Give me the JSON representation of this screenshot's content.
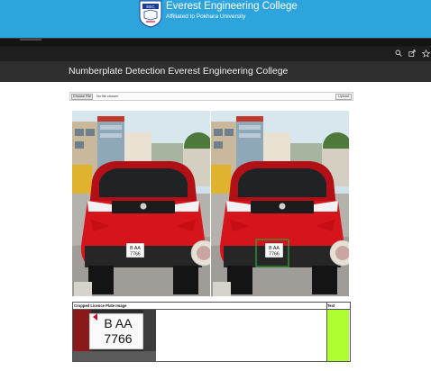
{
  "header": {
    "college_name": "Everest Engineering College",
    "affiliation": "Affiliated to Pokhara University",
    "logo_text": "EEC",
    "banner_color": "#2ea4dd"
  },
  "toolbar": {
    "icons": [
      "zoom-icon",
      "share-icon",
      "star-icon"
    ]
  },
  "app": {
    "title": "Numberplate Detection Everest Engineering College"
  },
  "upload": {
    "choose_label": "Choose File",
    "file_status": "No file chosen",
    "upload_label": "Upload"
  },
  "images": {
    "original": {
      "plate_line1": "B AA",
      "plate_line2": "7766",
      "car_color": "#d6141c"
    },
    "detected": {
      "plate_line1": "B AA",
      "plate_line2": "7766",
      "box_color": "#2e9e3a"
    }
  },
  "result": {
    "col_crop": "Cropped Licence Plate Image",
    "col_text": "Text",
    "crop_line1": "B AA",
    "crop_line2": "7766",
    "text_value": "",
    "text_cell_color": "#adff2f"
  }
}
